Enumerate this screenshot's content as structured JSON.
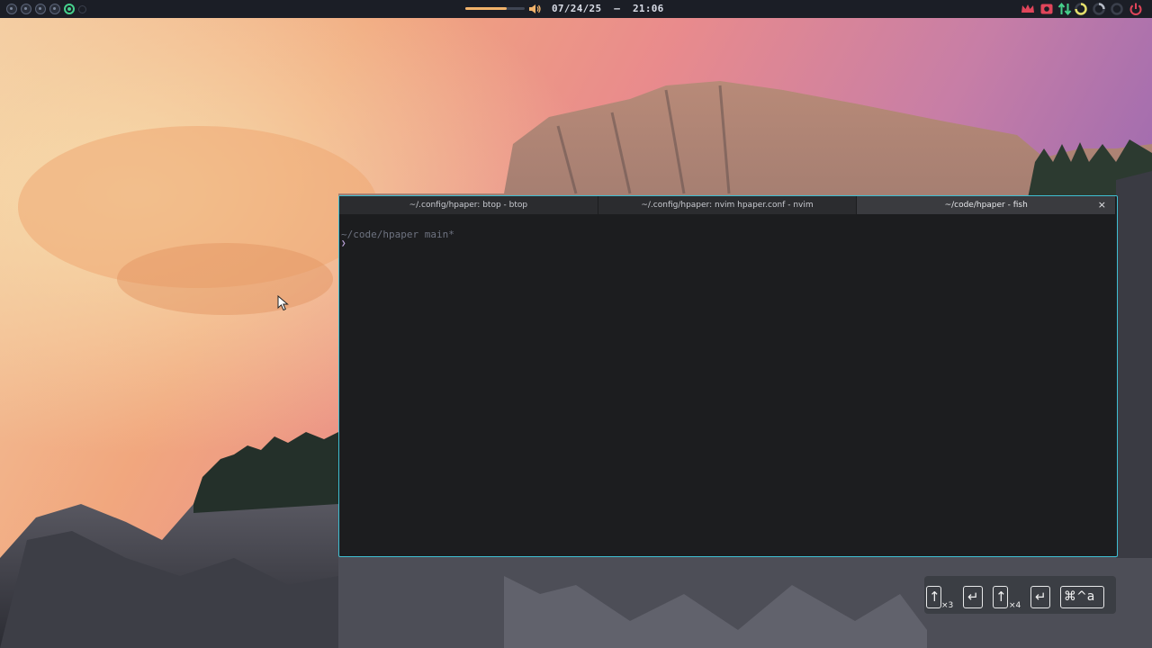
{
  "topbar": {
    "workspaces": [
      {
        "state": "idle"
      },
      {
        "state": "idle"
      },
      {
        "state": "idle"
      },
      {
        "state": "idle"
      },
      {
        "state": "active"
      },
      {
        "state": "dim"
      }
    ],
    "volume_level": 0.7,
    "volume_icon": "speaker-volume-icon",
    "clock": "07/24/25  –  21:06",
    "tray": [
      {
        "icon": "crown-icon",
        "color": "#e0455a"
      },
      {
        "icon": "record-icon",
        "color": "#e0455a"
      },
      {
        "icon": "network-updown-icon",
        "color": "#46d18c"
      },
      {
        "icon": "cpu-ring-icon",
        "color": "#e4e06b"
      },
      {
        "icon": "memory-ring-icon",
        "color": "#b7bcc7"
      },
      {
        "icon": "disk-ring-icon",
        "color": "#3a3f4b"
      },
      {
        "icon": "power-icon",
        "color": "#e0455a"
      }
    ]
  },
  "terminal": {
    "tabs": [
      {
        "label": "~/.config/hpaper: btop - btop"
      },
      {
        "label": "~/.config/hpaper: nvim hpaper.conf - nvim"
      },
      {
        "label": "~/code/hpaper - fish"
      }
    ],
    "active_tab": 2,
    "close_glyph": "×",
    "prompt_path": "~/code/hpaper main*",
    "prompt_symbol": "❯"
  },
  "key_overlay": {
    "keys": [
      {
        "glyph": "↑",
        "mult": "×3",
        "icon": "arrow-up-icon"
      },
      {
        "glyph": "↵",
        "mult": "",
        "icon": "return-icon"
      },
      {
        "glyph": "↑",
        "mult": "×4",
        "icon": "arrow-up-icon"
      },
      {
        "glyph": "↵",
        "mult": "",
        "icon": "return-icon"
      },
      {
        "glyph": "⌘^a",
        "mult": "",
        "icon": "super-ctrl-a-icon"
      }
    ]
  }
}
